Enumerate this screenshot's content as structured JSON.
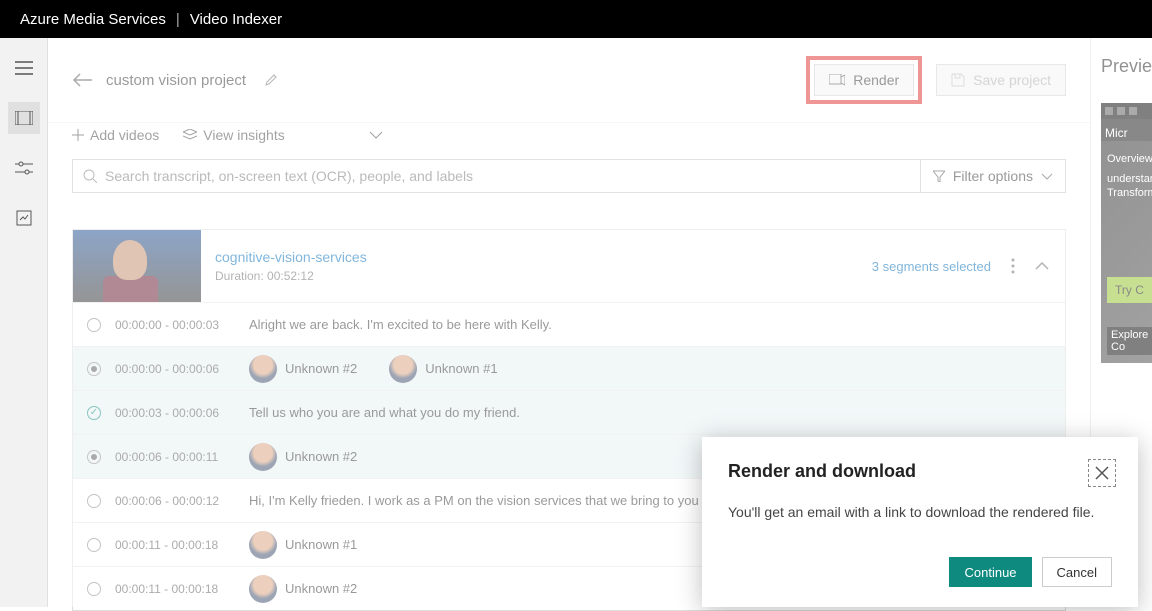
{
  "topbar": {
    "service": "Azure Media Services",
    "product": "Video Indexer"
  },
  "project": {
    "name": "custom vision project"
  },
  "buttons": {
    "render": "Render",
    "save": "Save project"
  },
  "toolbar": {
    "add_videos": "Add videos",
    "view_insights": "View insights"
  },
  "search": {
    "placeholder": "Search transcript, on-screen text (OCR), people, and labels",
    "filter": "Filter options"
  },
  "video": {
    "name": "cognitive-vision-services",
    "duration_label": "Duration: 00:52:12",
    "segments_selected": "3 segments selected"
  },
  "rows": [
    {
      "selected": false,
      "indicator": "empty",
      "time": "00:00:00 - 00:00:03",
      "type": "text",
      "text": "Alright we are back. I'm excited to be here with Kelly."
    },
    {
      "selected": true,
      "indicator": "dot",
      "time": "00:00:00 - 00:00:06",
      "type": "speakers",
      "speakers": [
        "Unknown #2",
        "Unknown #1"
      ]
    },
    {
      "selected": true,
      "indicator": "check",
      "time": "00:00:03 - 00:00:06",
      "type": "text",
      "text": "Tell us who you are and what you do my friend."
    },
    {
      "selected": true,
      "indicator": "dot",
      "time": "00:00:06 - 00:00:11",
      "type": "speakers",
      "speakers": [
        "Unknown #2"
      ]
    },
    {
      "selected": false,
      "indicator": "empty",
      "time": "00:00:06 - 00:00:12",
      "type": "text",
      "text": "Hi, I'm Kelly frieden. I work as a PM on the vision services that we bring to you thr"
    },
    {
      "selected": false,
      "indicator": "empty",
      "time": "00:00:11 - 00:00:18",
      "type": "speakers",
      "speakers": [
        "Unknown #1"
      ]
    },
    {
      "selected": false,
      "indicator": "empty",
      "time": "00:00:11 - 00:00:18",
      "type": "speakers",
      "speakers": [
        "Unknown #2"
      ]
    }
  ],
  "preview": {
    "title": "Preview",
    "stub": {
      "brand": "Micr",
      "line1": "Overview",
      "line2": "understan",
      "line3": "Transform",
      "cta": "Try C",
      "footer": "Explore Co"
    }
  },
  "dialog": {
    "title": "Render and download",
    "message": "You'll get an email with a link to download the rendered file.",
    "continue": "Continue",
    "cancel": "Cancel"
  }
}
